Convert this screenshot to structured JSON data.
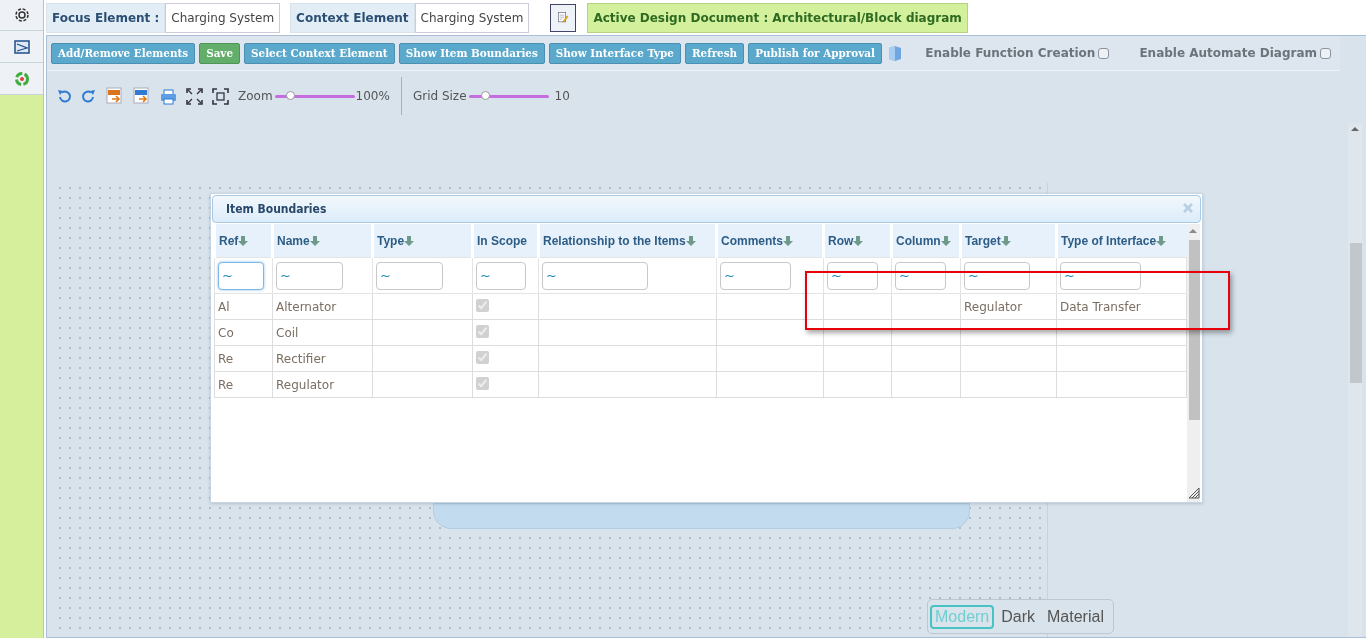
{
  "focus_element": {
    "label": "Focus Element :",
    "value": "Charging System"
  },
  "context_element": {
    "label": "Context Element",
    "value": "Charging System"
  },
  "active_document": "Active Design Document : Architectural/Block diagram",
  "toolbar": {
    "buttons": [
      {
        "label": "Add/Remove Elements",
        "kind": "info"
      },
      {
        "label": "Save",
        "kind": "success"
      },
      {
        "label": "Select Context Element",
        "kind": "info"
      },
      {
        "label": "Show Item Boundaries",
        "kind": "info"
      },
      {
        "label": "Show Interface Type",
        "kind": "info"
      },
      {
        "label": "Refresh",
        "kind": "info"
      },
      {
        "label": "Publish for Approval",
        "kind": "info"
      }
    ],
    "options": [
      {
        "label": "Enable Function Creation",
        "checked": false
      },
      {
        "label": "Enable Automate Diagram",
        "checked": false
      }
    ]
  },
  "diagram_tools": {
    "exports": [
      {
        "kind": "svg"
      },
      {
        "kind": "png"
      }
    ],
    "zoom": {
      "label": "Zoom",
      "level": 0.19,
      "reading": "100%"
    },
    "grid": {
      "label": "Grid Size",
      "level": 0.21,
      "reading": "10"
    }
  },
  "dialog": {
    "title": "Item Boundaries",
    "columns": [
      {
        "label": "Ref",
        "sortable": true,
        "filter": "~"
      },
      {
        "label": "Name",
        "sortable": true,
        "filter": "~"
      },
      {
        "label": "Type",
        "sortable": true,
        "filter": "~"
      },
      {
        "label": "In Scope",
        "sortable": false,
        "filter": "~"
      },
      {
        "label": "Relationship to the Items",
        "sortable": true,
        "filter": "~"
      },
      {
        "label": "Comments",
        "sortable": true,
        "filter": "~"
      },
      {
        "label": "Row",
        "sortable": true,
        "filter": "~"
      },
      {
        "label": "Column",
        "sortable": true,
        "filter": "~"
      },
      {
        "label": "Target",
        "sortable": true,
        "filter": "~"
      },
      {
        "label": "Type of Interface",
        "sortable": true,
        "filter": "~"
      }
    ],
    "rows": [
      {
        "ref": "Al",
        "name": "Alternator",
        "in_scope": true,
        "target": "Regulator",
        "type_of_interface": "Data Transfer"
      },
      {
        "ref": "Co",
        "name": "Coil",
        "in_scope": true
      },
      {
        "ref": "Re",
        "name": "Rectifier",
        "in_scope": true
      },
      {
        "ref": "Re",
        "name": "Regulator",
        "in_scope": true
      }
    ]
  },
  "themes": [
    {
      "label": "Modern",
      "selected": true
    },
    {
      "label": "Dark",
      "selected": false
    },
    {
      "label": "Material",
      "selected": false
    }
  ]
}
